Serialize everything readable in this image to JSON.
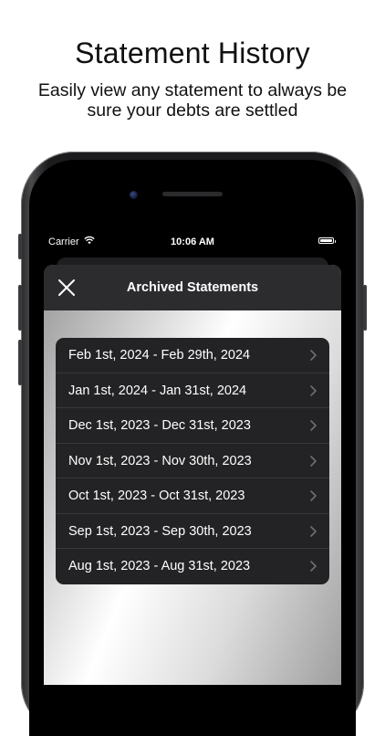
{
  "promo": {
    "title": "Statement History",
    "subtitle": "Easily view any statement to always be sure your debts are settled"
  },
  "status_bar": {
    "carrier": "Carrier",
    "time": "10:06 AM",
    "icons": [
      "wifi-icon",
      "battery-icon"
    ]
  },
  "navbar": {
    "title": "Archived Statements",
    "close_icon": "close-icon"
  },
  "statements": [
    "Feb 1st, 2024 - Feb 29th, 2024",
    "Jan 1st, 2024 - Jan 31st, 2024",
    "Dec 1st, 2023 - Dec 31st, 2023",
    "Nov 1st, 2023 - Nov 30th, 2023",
    "Oct 1st, 2023 - Oct 31st, 2023",
    "Sep 1st, 2023 - Sep 30th, 2023",
    "Aug 1st, 2023 - Aug 31st, 2023"
  ],
  "colors": {
    "navbar": "#2c2c2e",
    "list_background": "#232325",
    "separator": "#38383a",
    "chevron": "#6e6e73"
  }
}
